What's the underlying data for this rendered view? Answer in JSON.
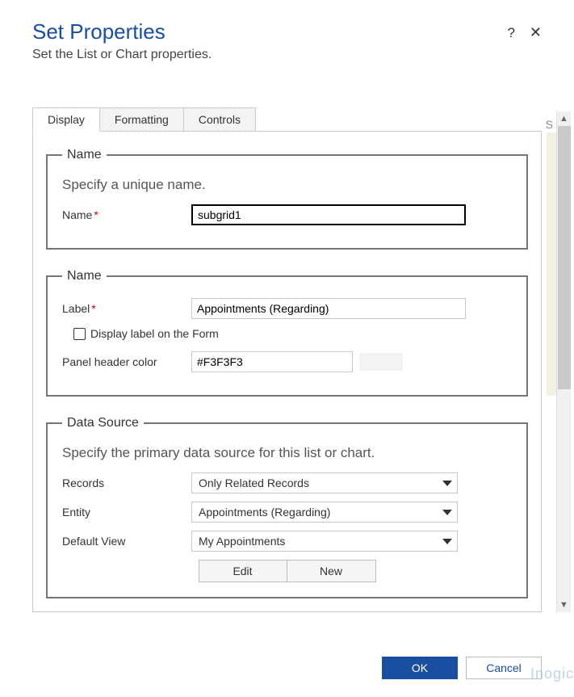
{
  "dialog": {
    "title": "Set Properties",
    "subtitle": "Set the List or Chart properties.",
    "help": "?",
    "close": "✕"
  },
  "tabs": [
    "Display",
    "Formatting",
    "Controls"
  ],
  "section_name1": {
    "legend": "Name",
    "desc": "Specify a unique name.",
    "name_label": "Name",
    "name_value": "subgrid1"
  },
  "section_name2": {
    "legend": "Name",
    "label_label": "Label",
    "label_value": "Appointments (Regarding)",
    "display_label_checkbox": "Display label on the Form",
    "panel_color_label": "Panel header color",
    "panel_color_value": "#F3F3F3"
  },
  "section_ds": {
    "legend": "Data Source",
    "desc": "Specify the primary data source for this list or chart.",
    "records_label": "Records",
    "records_value": "Only Related Records",
    "entity_label": "Entity",
    "entity_value": "Appointments (Regarding)",
    "view_label": "Default View",
    "view_value": "My Appointments",
    "edit": "Edit",
    "new": "New"
  },
  "footer": {
    "ok": "OK",
    "cancel": "Cancel"
  },
  "watermark": "Inogic",
  "edge_letter": "S"
}
